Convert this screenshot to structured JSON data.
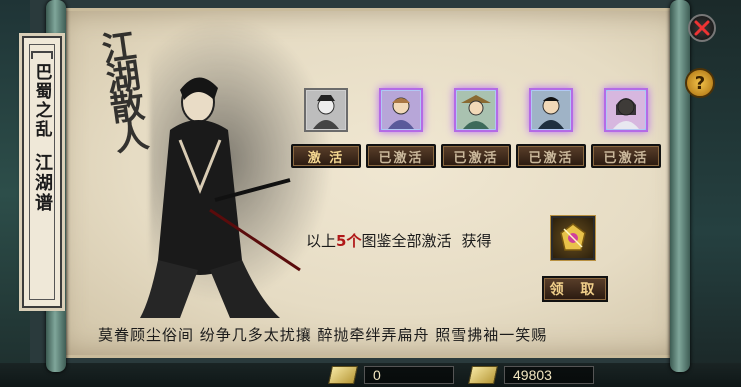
{
  "banner": {
    "chapter": "巴蜀之乱",
    "title": "江湖谱"
  },
  "art": {
    "calligraphy": "江湖散人"
  },
  "heroes": [
    {
      "name": "hero-1",
      "button": "激 活",
      "active": false
    },
    {
      "name": "hero-2",
      "button": "已激活",
      "active": true
    },
    {
      "name": "hero-3",
      "button": "已激活",
      "active": true
    },
    {
      "name": "hero-4",
      "button": "已激活",
      "active": true
    },
    {
      "name": "hero-5",
      "button": "已激活",
      "active": true
    }
  ],
  "reward": {
    "prefix": "以上",
    "count": "5个",
    "suffix": "图鉴全部激活",
    "get": "获得",
    "claim": "领 取"
  },
  "poem": "莫眷顾尘俗间  纷争几多太扰攘  醉抛牵绊弄扁舟  照雪拂袖一笑赐",
  "resources": {
    "first": "0",
    "second": "49803"
  },
  "help": "?",
  "colors": {
    "parchment": "#e6dcc4",
    "active_glow": "#b86ef0",
    "button_text": "#e8c888",
    "count_red": "#b01818"
  }
}
